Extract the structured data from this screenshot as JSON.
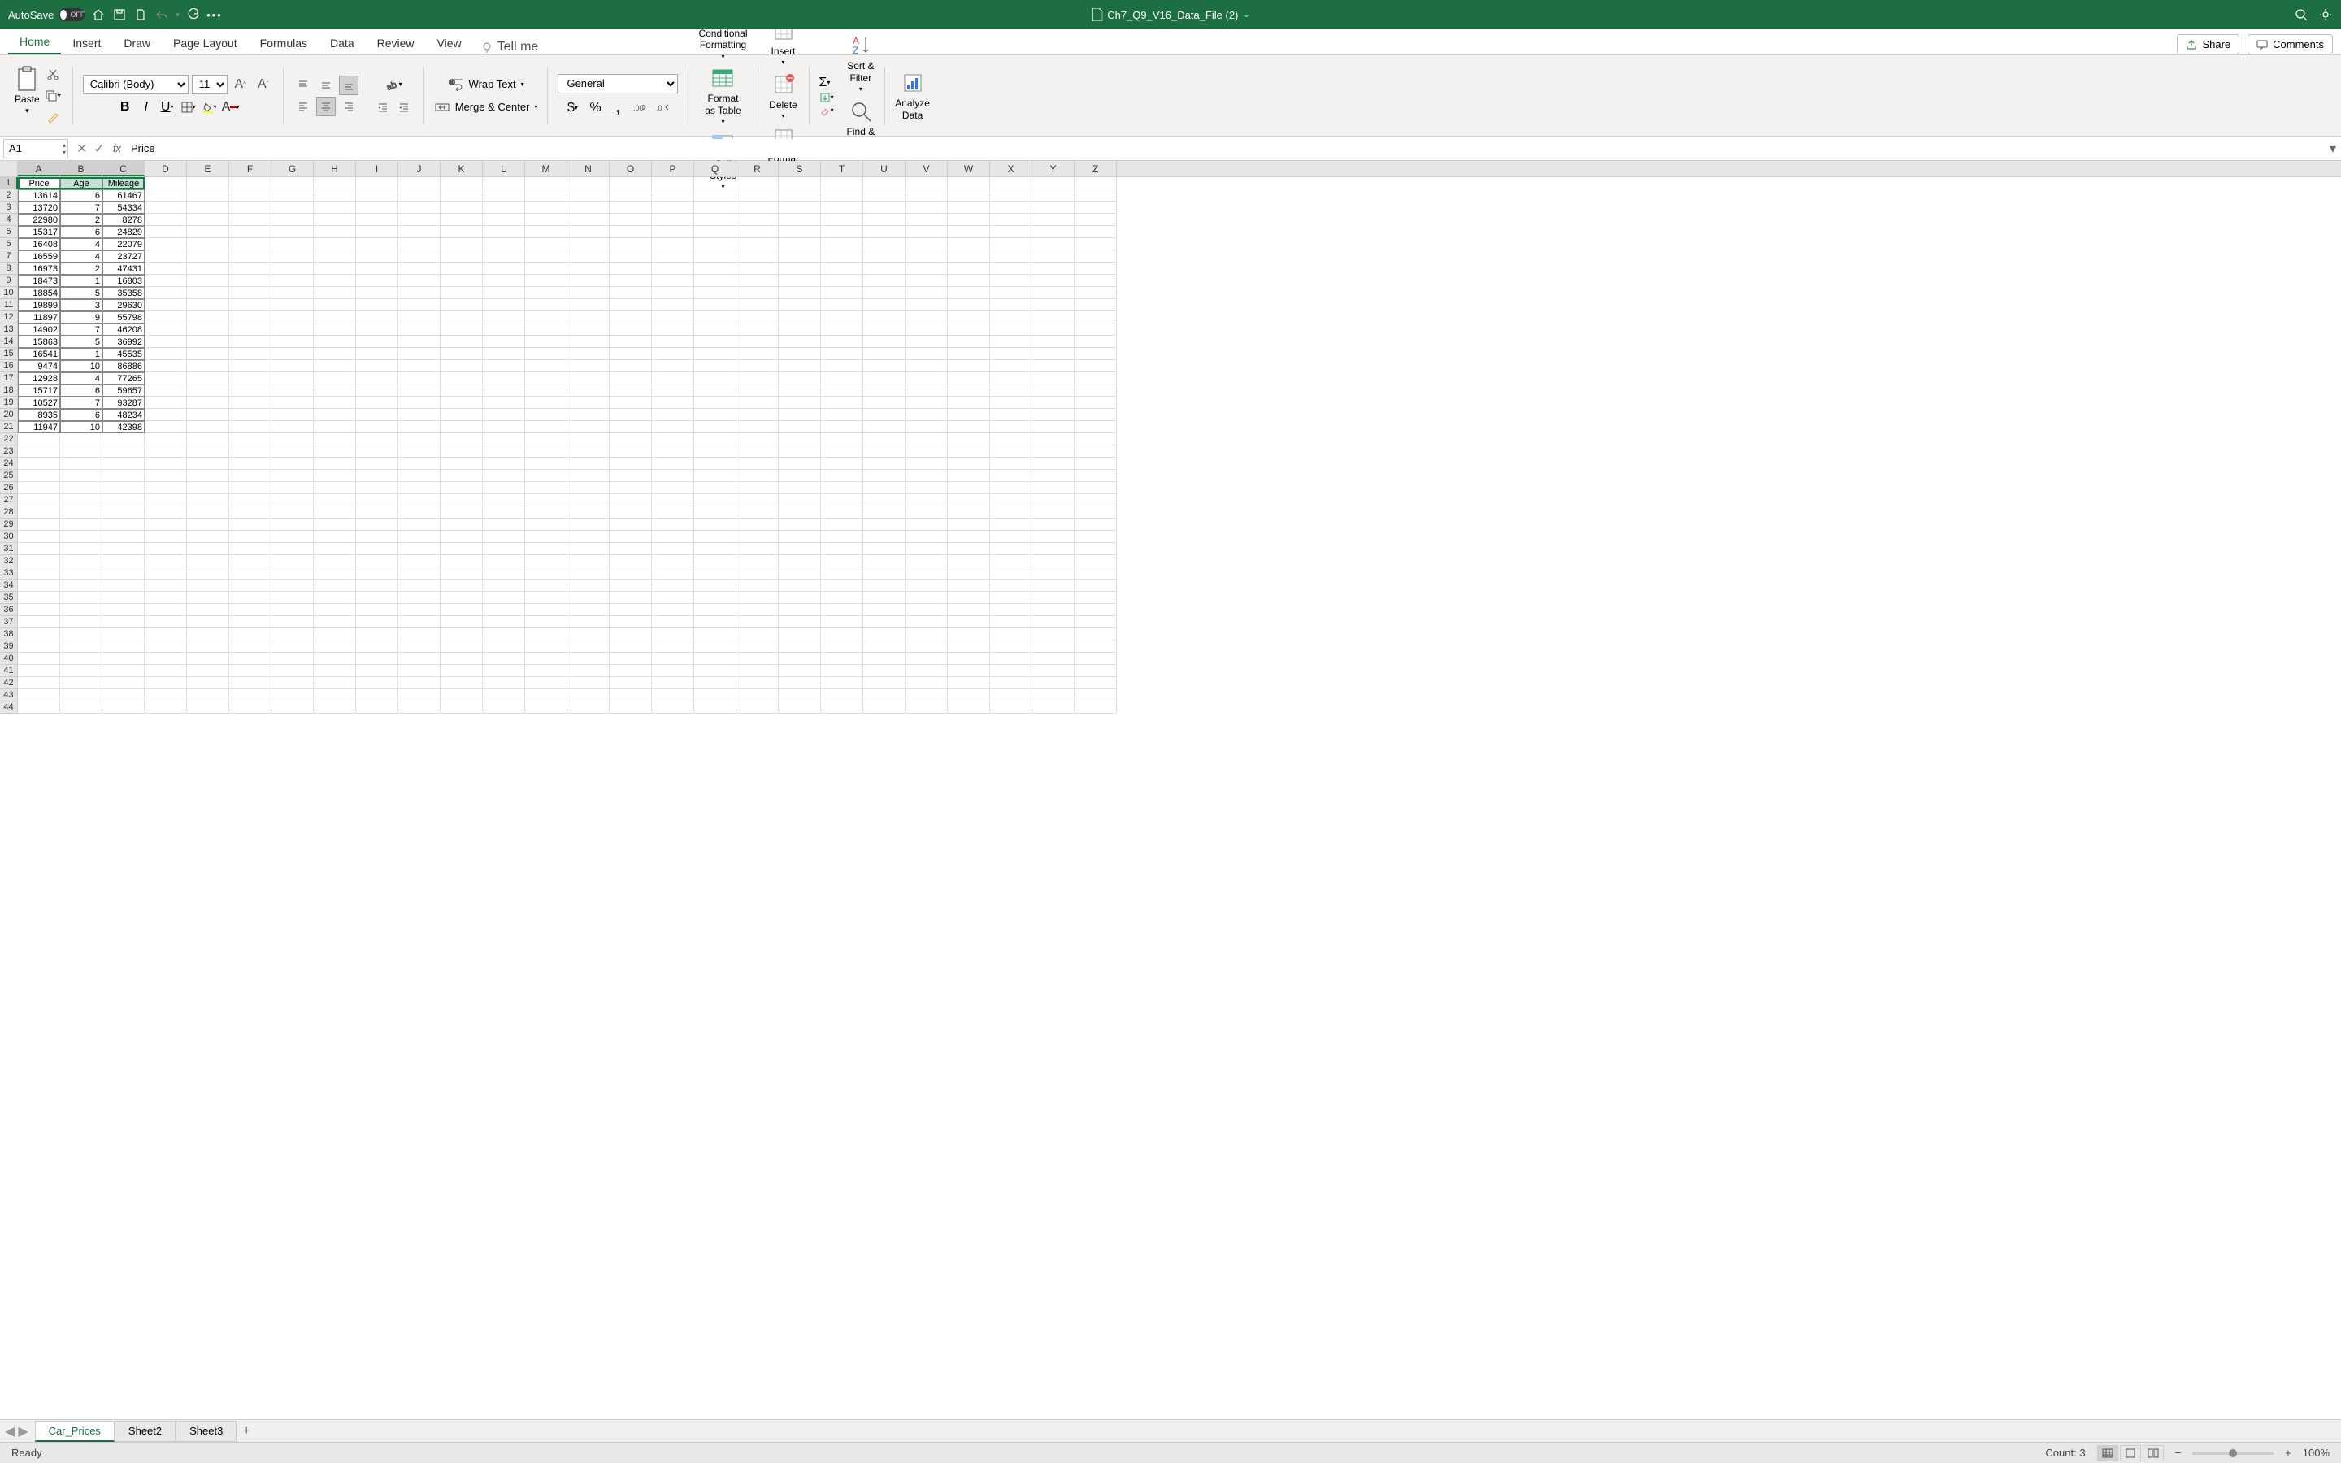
{
  "titlebar": {
    "autosave_label": "AutoSave",
    "autosave_state": "OFF",
    "doc_title": "Ch7_Q9_V16_Data_File (2)"
  },
  "tabs": {
    "items": [
      "Home",
      "Insert",
      "Draw",
      "Page Layout",
      "Formulas",
      "Data",
      "Review",
      "View"
    ],
    "active": 0,
    "tellme": "Tell me",
    "share": "Share",
    "comments": "Comments"
  },
  "ribbon": {
    "paste": "Paste",
    "font_name": "Calibri (Body)",
    "font_size": "11",
    "wrap_text": "Wrap Text",
    "merge_center": "Merge & Center",
    "number_format": "General",
    "conditional_formatting": "Conditional\nFormatting",
    "format_as_table": "Format\nas Table",
    "cell_styles": "Cell\nStyles",
    "insert": "Insert",
    "delete": "Delete",
    "format": "Format",
    "sort_filter": "Sort &\nFilter",
    "find_select": "Find &\nSelect",
    "analyze_data": "Analyze\nData"
  },
  "formula_bar": {
    "name_box": "A1",
    "formula": "Price"
  },
  "columns": [
    "A",
    "B",
    "C",
    "D",
    "E",
    "F",
    "G",
    "H",
    "I",
    "J",
    "K",
    "L",
    "M",
    "N",
    "O",
    "P",
    "Q",
    "R",
    "S",
    "T",
    "U",
    "V",
    "W",
    "X",
    "Y",
    "Z"
  ],
  "rows_shown": 44,
  "selected_cols": [
    0,
    1,
    2
  ],
  "selected_row": 0,
  "selection": {
    "r0": 0,
    "c0": 0,
    "r1": 0,
    "c1": 2
  },
  "data_headers": [
    "Price",
    "Age",
    "Mileage"
  ],
  "data_rows": [
    [
      13614,
      6,
      61467
    ],
    [
      13720,
      7,
      54334
    ],
    [
      22980,
      2,
      8278
    ],
    [
      15317,
      6,
      24829
    ],
    [
      16408,
      4,
      22079
    ],
    [
      16559,
      4,
      23727
    ],
    [
      16973,
      2,
      47431
    ],
    [
      18473,
      1,
      16803
    ],
    [
      18854,
      5,
      35358
    ],
    [
      19899,
      3,
      29630
    ],
    [
      11897,
      9,
      55798
    ],
    [
      14902,
      7,
      46208
    ],
    [
      15863,
      5,
      36992
    ],
    [
      16541,
      1,
      45535
    ],
    [
      9474,
      10,
      86886
    ],
    [
      12928,
      4,
      77265
    ],
    [
      15717,
      6,
      59657
    ],
    [
      10527,
      7,
      93287
    ],
    [
      8935,
      6,
      48234
    ],
    [
      11947,
      10,
      42398
    ]
  ],
  "sheets": {
    "items": [
      "Car_Prices",
      "Sheet2",
      "Sheet3"
    ],
    "active": 0
  },
  "status": {
    "ready": "Ready",
    "count_label": "Count:",
    "count_value": "3",
    "zoom": "100%"
  }
}
